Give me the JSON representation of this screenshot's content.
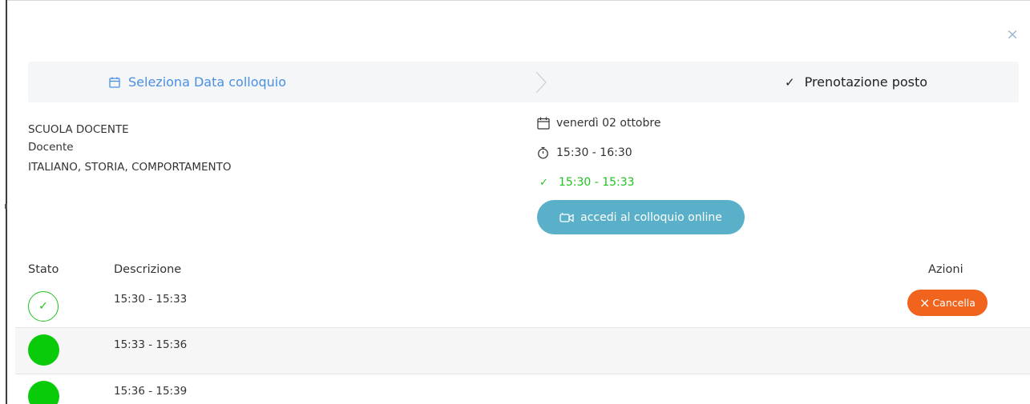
{
  "close_glyph": "×",
  "steps": {
    "step1_label": "Seleziona Data colloquio",
    "step2_check": "✓",
    "step2_label": "Prenotazione posto"
  },
  "teacher": {
    "school": "SCUOLA DOCENTE",
    "role": "Docente",
    "subjects": "ITALIANO, STORIA, COMPORTAMENTO"
  },
  "details": {
    "date": "venerdì 02 ottobre",
    "time_range": "15:30 - 16:30",
    "booked_check": "✓",
    "booked_slot": "15:30 - 15:33",
    "online_button": "accedi al colloquio online"
  },
  "table": {
    "headers": {
      "status": "Stato",
      "description": "Descrizione",
      "actions": "Azioni"
    },
    "rows": [
      {
        "time": "15:30 - 15:33",
        "status_icon": "check-circle-icon",
        "status_glyph": "✓",
        "action": "Cancella",
        "action_glyph": "×"
      },
      {
        "time": "15:33 - 15:36",
        "status_icon": "green-dot-icon"
      },
      {
        "time": "15:36 - 15:39",
        "status_icon": "green-dot-icon"
      }
    ]
  },
  "colors": {
    "accent_blue": "#4a90e2",
    "online_button": "#5ab0c8",
    "success_green": "#1fc31f",
    "cancel_orange": "#f0641e"
  }
}
